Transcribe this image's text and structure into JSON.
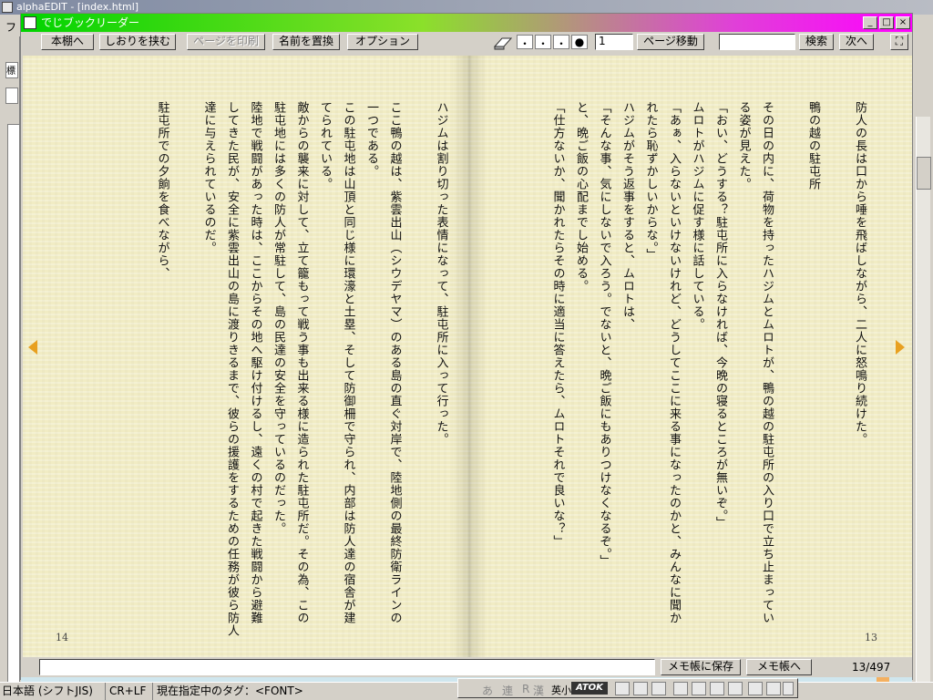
{
  "background_app": {
    "title": "alphaEDIT - [index.html]",
    "menu_first": "ファ",
    "left_label": "標"
  },
  "reader": {
    "title": "でじブックリーダー",
    "window_buttons": {
      "minimize": "_",
      "maximize": "□",
      "close": "×"
    },
    "toolbar": {
      "bookshelf": "本棚へ",
      "bookmark": "しおりを挟む",
      "print": "ページを印刷",
      "replace_name": "名前を置換",
      "options": "オプション",
      "font_sizes": [
        "・",
        "・",
        "・",
        "●"
      ],
      "page_input": "1",
      "page_jump": "ページ移動",
      "search_value": "",
      "search": "検索",
      "next": "次へ",
      "fullscreen": "⛶"
    },
    "right_page": {
      "number": "13",
      "columns": [
        "防人の長は口から唾を飛ばしながら、二人に怒鳴り続けた。",
        "",
        "鴨の越の駐屯所",
        "",
        "その日の内に、荷物を持ったハジムとムロトが、鴨の越の駐屯所の入り口で立ち止まってい",
        "る姿が見えた。",
        "「おい、どうする？駐屯所に入らなければ、今晩の寝るところが無いぞ。」",
        "ムロトがハジムに促す様に話している。",
        "「あぁ、入らないといけないけれど、どうしてここに来る事になったのかと、みんなに聞か",
        "れたら恥ずかしいからな。」",
        "ハジムがそう返事をすると、ムロトは、",
        "「そんな事、気にしないで入ろう。でないと、晩ご飯にもありつけなくなるぞ。」",
        "と、晩ご飯の心配までし始める。",
        "「仕方ないか、聞かれたらその時に適当に答えたら、ムロトそれで良いな？」"
      ]
    },
    "left_page": {
      "number": "14",
      "columns": [
        "",
        "ハジムは割り切った表情になって、駐屯所に入って行った。",
        "",
        "ここ鴨の越は、紫雲出山（シウデヤマ）のある島の直ぐ対岸で、陸地側の最終防衛ラインの",
        "一つである。",
        "この駐屯地は山頂と同じ様に環濠と土塁、そして防御柵で守られ、内部は防人達の宿舎が建",
        "てられている。",
        "敵からの襲来に対して、立て籠もって戦う事も出来る様に造られた駐屯所だ。その為、この",
        "駐屯地には多くの防人が常駐して、島の民達の安全を守っているのだった。",
        "陸地で戦闘があった時は、ここからその地へ駆け付けるし、遠くの村で起きた戦闘から避難",
        "してきた民が、安全に紫雲出山の島に渡りきるまで、彼らの援護をするための任務が彼ら防人",
        "達に与えられているのだ。",
        "",
        "駐屯所での夕餉を食べながら、"
      ]
    },
    "memo": {
      "input_value": "",
      "save": "メモ帳に保存",
      "open": "メモ帳へ",
      "page_count": "13/497"
    },
    "progress": 0.026
  },
  "statusbar": {
    "encoding": "日本語 (シフトJIS)",
    "line_ending": "CR+LF",
    "tag": "現在指定中のタグ：<FONT>"
  },
  "ime": {
    "items": [
      "あ",
      "連",
      "R",
      "漢",
      "英小"
    ],
    "atok": "ATOK"
  }
}
